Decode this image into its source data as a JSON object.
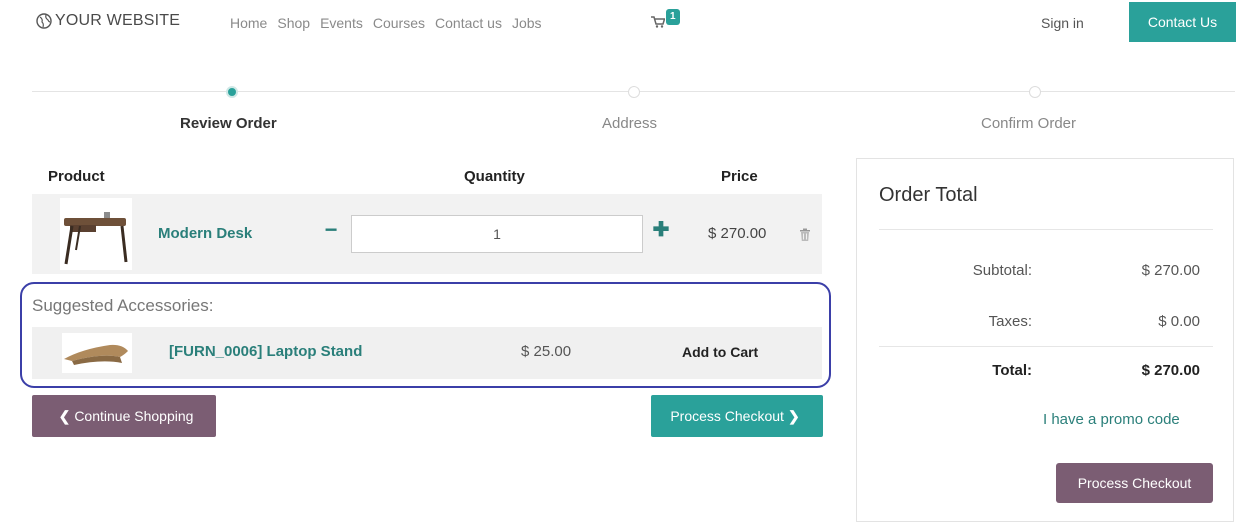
{
  "navbar": {
    "brand": "YOUR WEBSITE",
    "menu": [
      "Home",
      "Shop",
      "Events",
      "Courses",
      "Contact us",
      "Jobs"
    ],
    "cart_count": "1",
    "sign_in": "Sign in",
    "contact_button": "Contact Us"
  },
  "progress": {
    "steps": [
      {
        "label": "Review Order",
        "active": true
      },
      {
        "label": "Address",
        "active": false
      },
      {
        "label": "Confirm Order",
        "active": false
      }
    ]
  },
  "cart_table": {
    "headers": {
      "product": "Product",
      "quantity": "Quantity",
      "price": "Price"
    },
    "rows": [
      {
        "name": "Modern Desk",
        "quantity": "1",
        "price": "$ 270.00"
      }
    ]
  },
  "suggested": {
    "title": "Suggested Accessories:",
    "items": [
      {
        "name": "[FURN_0006] Laptop Stand",
        "price": "$ 25.00",
        "action": "Add to Cart"
      }
    ]
  },
  "buttons": {
    "continue_shopping": "Continue Shopping",
    "process_checkout": "Process Checkout"
  },
  "order_total": {
    "title": "Order Total",
    "subtotal_label": "Subtotal:",
    "subtotal_value": "$ 270.00",
    "taxes_label": "Taxes:",
    "taxes_value": "$ 0.00",
    "total_label": "Total:",
    "total_value": "$ 270.00",
    "promo": "I have a promo code",
    "checkout_button": "Process Checkout"
  },
  "colors": {
    "accent": "#2aa19a",
    "secondary": "#7b5d73",
    "link": "#2a7f7a",
    "highlight_border": "#3b3fa8"
  }
}
